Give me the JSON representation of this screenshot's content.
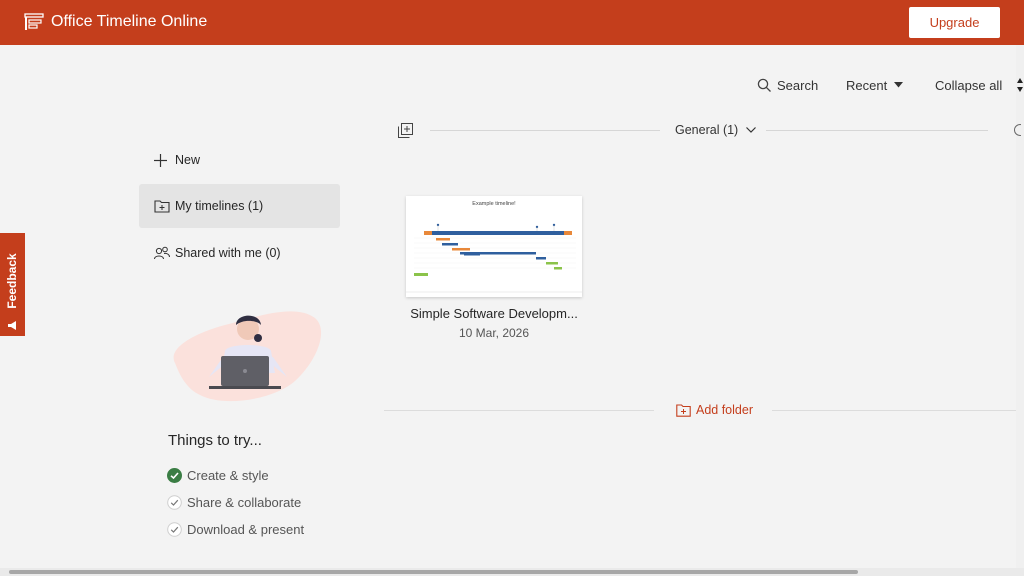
{
  "app": {
    "title": "Office Timeline Online",
    "upgrade_label": "Upgrade"
  },
  "toolbar": {
    "search_label": "Search",
    "recent_label": "Recent",
    "collapse_label": "Collapse all"
  },
  "feedback": {
    "label": "Feedback"
  },
  "sidebar": {
    "new_label": "New",
    "my_timelines_label": "My timelines (1)",
    "shared_label": "Shared with me (0)"
  },
  "things": {
    "title": "Things to try...",
    "items": [
      {
        "label": "Create & style",
        "done": true
      },
      {
        "label": "Share & collaborate",
        "done": false
      },
      {
        "label": "Download & present",
        "done": false
      }
    ]
  },
  "group": {
    "label": "General (1)"
  },
  "timeline_card": {
    "title": "Simple Software Developm...",
    "date": "10 Mar, 2026",
    "preview_title": "Example timeline!"
  },
  "add_folder_label": "Add folder",
  "colors": {
    "brand": "#c43e1c",
    "check_done": "#3a7d44",
    "timeline_blue": "#2f5f9e",
    "orange": "#e8883a",
    "green": "#8bc34a"
  }
}
